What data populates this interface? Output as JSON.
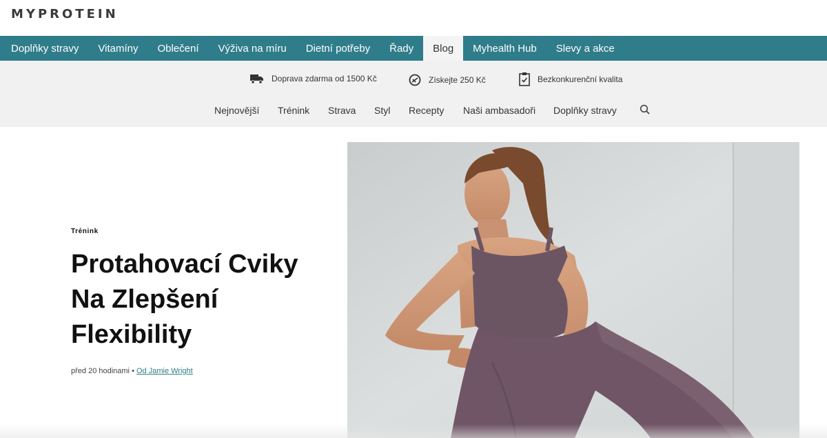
{
  "brand": {
    "logo_text": "MYPROTEIN"
  },
  "main_nav": {
    "items": [
      {
        "label": "Doplňky stravy"
      },
      {
        "label": "Vitamíny"
      },
      {
        "label": "Oblečení"
      },
      {
        "label": "Výživa na míru"
      },
      {
        "label": "Dietní potřeby"
      },
      {
        "label": "Řady"
      },
      {
        "label": "Blog",
        "active": true
      },
      {
        "label": "Myhealth Hub"
      },
      {
        "label": "Slevy a akce"
      }
    ],
    "accent_color": "#2f7d8a"
  },
  "usps": [
    {
      "icon": "truck-icon",
      "label": "Doprava zdarma od 1500 Kč"
    },
    {
      "icon": "coin-icon",
      "label": "Získejte 250 Kč"
    },
    {
      "icon": "clipboard-check-icon",
      "label": "Bezkonkurenční kvalita"
    }
  ],
  "blog_nav": {
    "items": [
      {
        "label": "Nejnovější"
      },
      {
        "label": "Trénink"
      },
      {
        "label": "Strava"
      },
      {
        "label": "Styl"
      },
      {
        "label": "Recepty"
      },
      {
        "label": "Naši ambasadoři"
      },
      {
        "label": "Doplňky stravy"
      }
    ],
    "search_icon": "search-icon"
  },
  "article": {
    "category": "Trénink",
    "title": "Protahovací Cviky Na Zlepšení Flexibility",
    "time_ago": "před 20 hodinami",
    "separator": "•",
    "author_link": "Od Jamie Wright"
  }
}
